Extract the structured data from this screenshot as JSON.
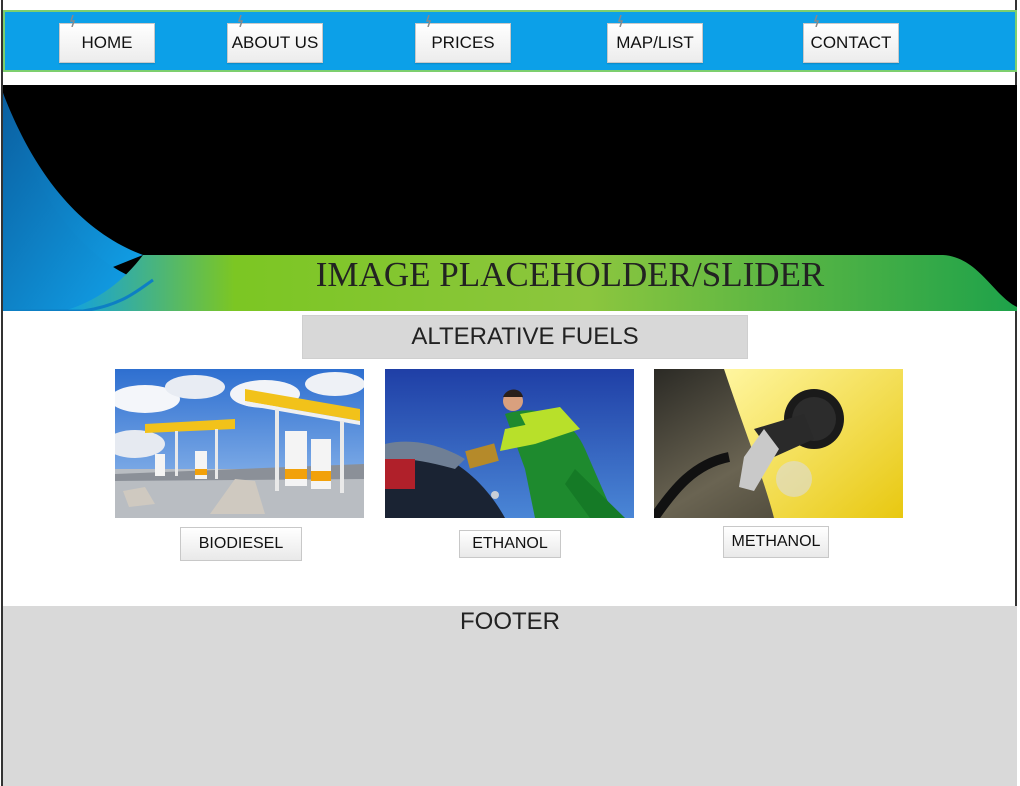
{
  "nav": {
    "items": [
      {
        "label": "HOME"
      },
      {
        "label": "ABOUT US"
      },
      {
        "label": "PRICES"
      },
      {
        "label": "MAP/LIST"
      },
      {
        "label": "CONTACT"
      }
    ]
  },
  "hero": {
    "title": "IMAGE PLACEHOLDER/SLIDER"
  },
  "section": {
    "title": "ALTERATIVE FUELS",
    "fuels": [
      {
        "label": "BIODIESEL",
        "image": "gas-station-photo"
      },
      {
        "label": "ETHANOL",
        "image": "refueling-worker-photo"
      },
      {
        "label": "METHANOL",
        "image": "fuel-nozzle-photo"
      }
    ]
  },
  "footer": {
    "label": "FOOTER"
  },
  "colors": {
    "nav_bg": "#0ca0e8",
    "nav_border": "#7ccf6e",
    "hero_bg": "#000000",
    "footer_bg": "#d9d9d9",
    "section_bg": "#d8d8d8"
  }
}
